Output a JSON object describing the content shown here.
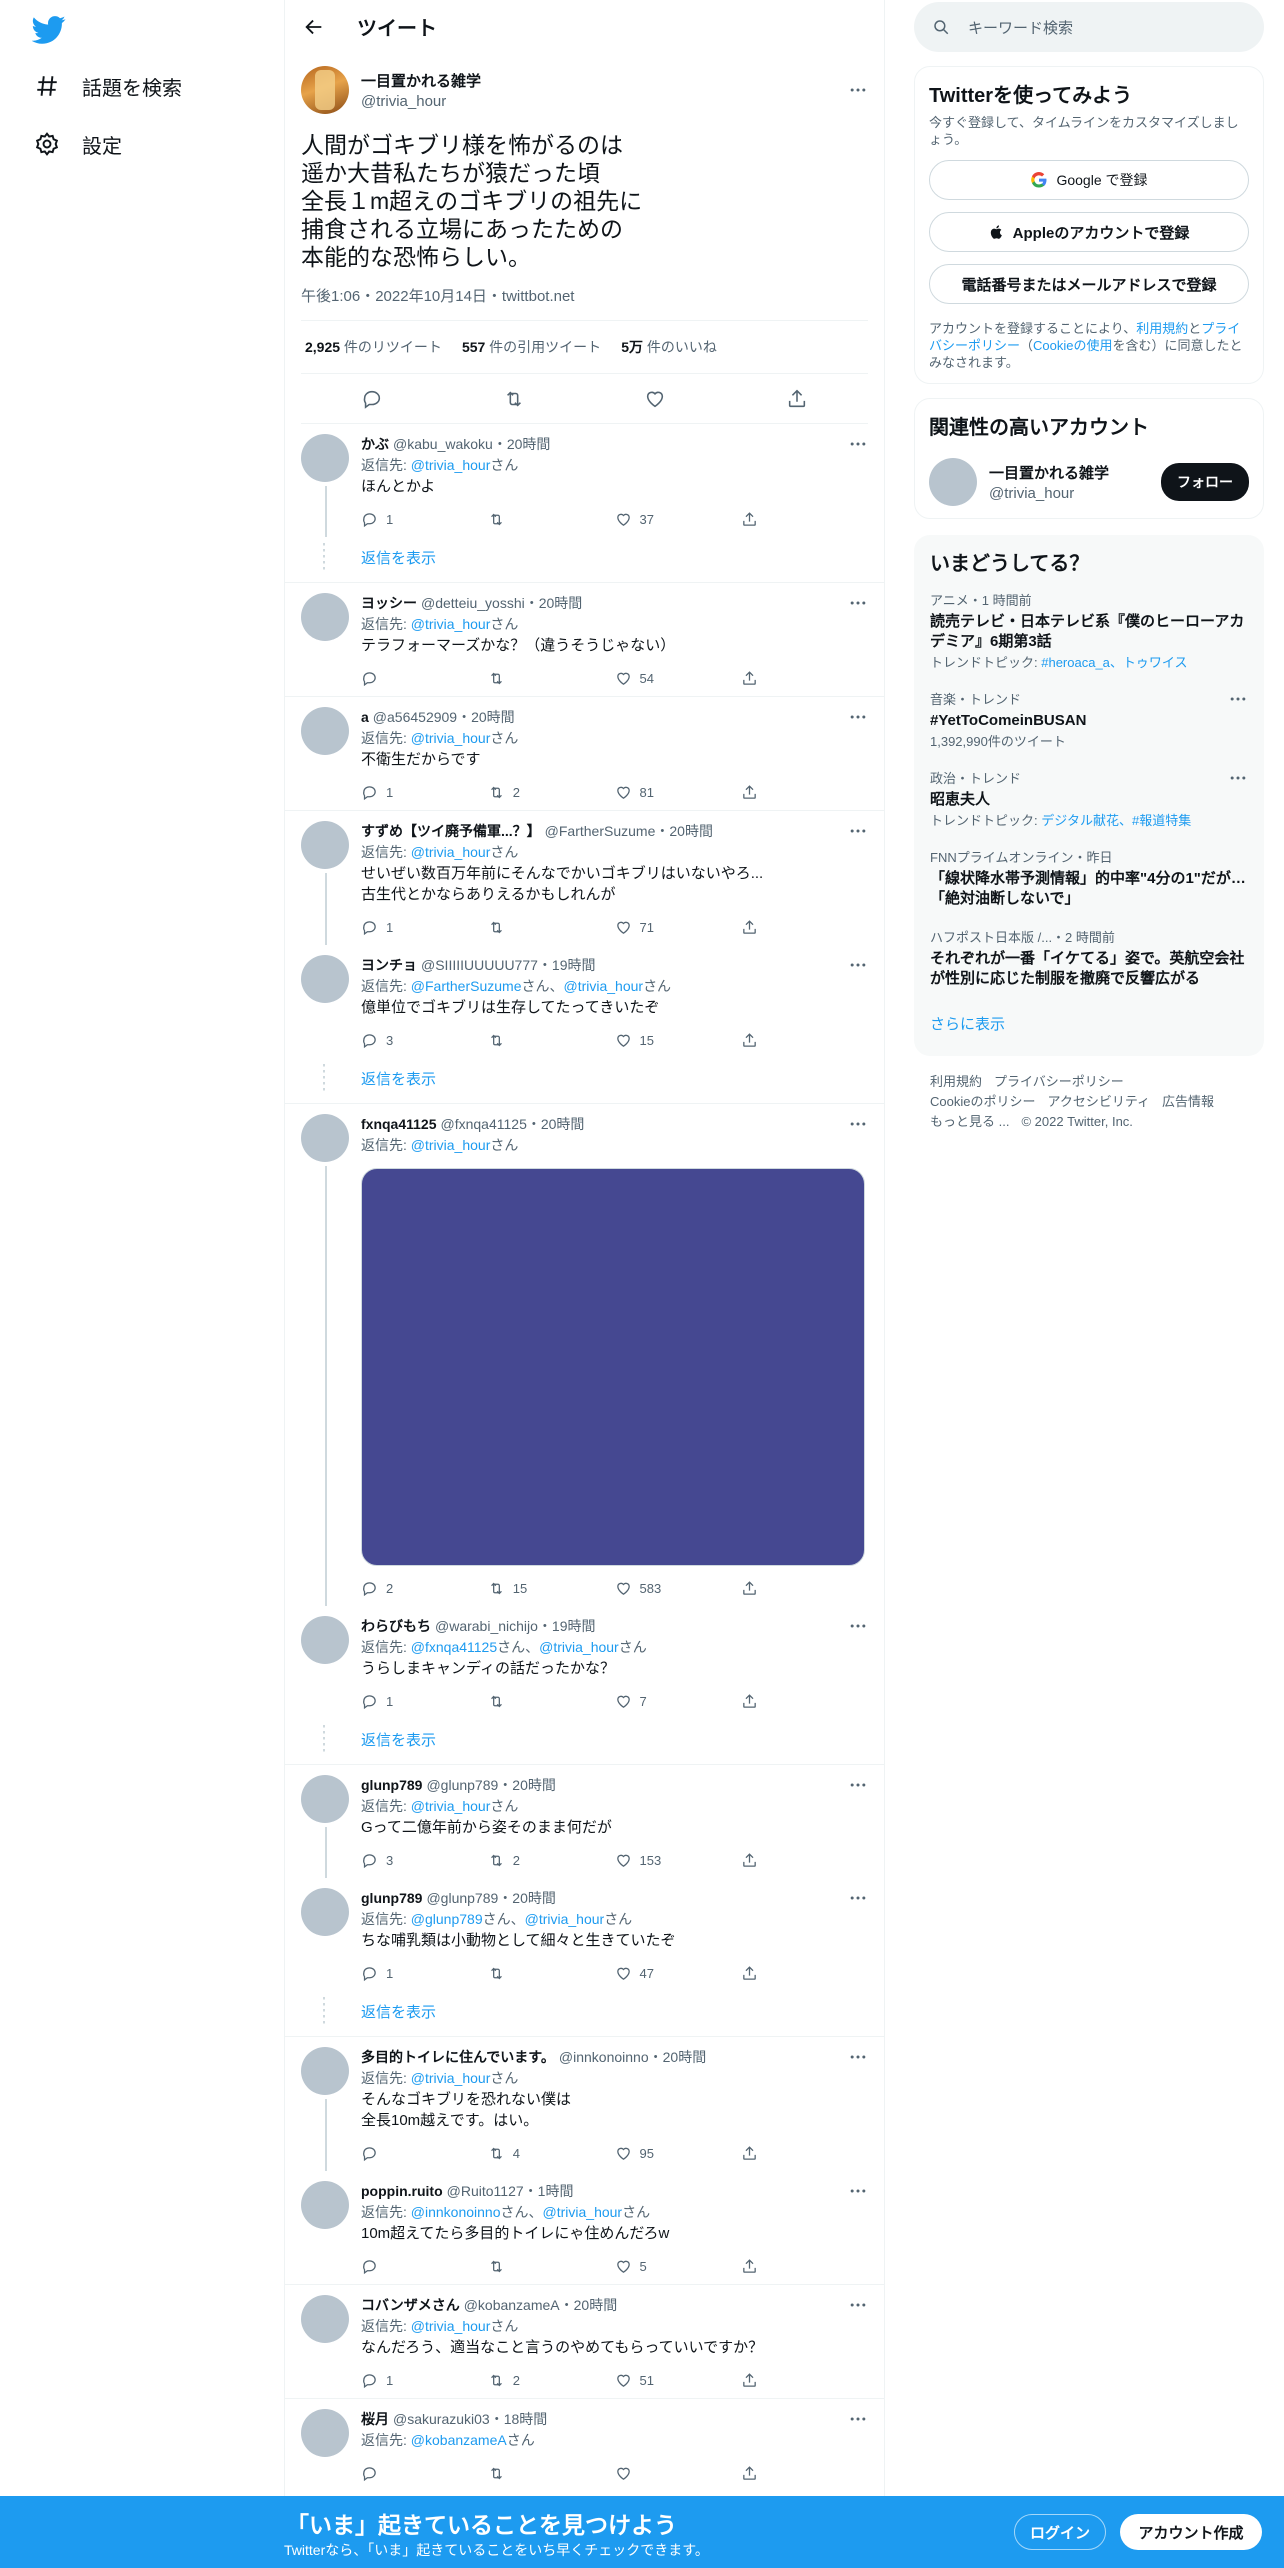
{
  "nav": {
    "explore": "話題を検索",
    "settings": "設定"
  },
  "header": {
    "title": "ツイート"
  },
  "main_tweet": {
    "name": "一目置かれる雑学",
    "handle": "@trivia_hour",
    "text": "人間がゴキブリ様を怖がるのは\n遥か大昔私たちが猿だった頃\n全長１m超えのゴキブリの祖先に\n捕食される立場にあったための\n本能的な恐怖らしい。",
    "meta": "午後1:06・2022年10月14日・twittbot.net",
    "retweets_count": "2,925",
    "retweets_label": " 件のリツイート",
    "quotes_count": "557",
    "quotes_label": " 件の引用ツイート",
    "likes_count": "5万",
    "likes_label": " 件のいいね"
  },
  "labels": {
    "reply_to": "返信先: ",
    "san": "さん",
    "comma": "、",
    "show_replies": "返信を表示"
  },
  "replies": [
    {
      "name": "かぶ",
      "handle": "@kabu_wakoku・20時間",
      "to": [
        "@trivia_hour"
      ],
      "text": "ほんとかよ",
      "reply": "1",
      "rt": "",
      "like": "37"
    },
    {
      "name": "ヨッシー",
      "handle": "@detteiu_yosshi・20時間",
      "to": [
        "@trivia_hour"
      ],
      "text": "テラフォーマーズかな？（違うそうじゃない）",
      "reply": "",
      "rt": "",
      "like": "54"
    },
    {
      "name": "a",
      "handle": "@a56452909・20時間",
      "to": [
        "@trivia_hour"
      ],
      "text": "不衛生だからです",
      "reply": "1",
      "rt": "2",
      "like": "81"
    },
    {
      "name": "すずめ【ツイ廃予備軍...？】",
      "handle": "@FartherSuzume・20時間",
      "to": [
        "@trivia_hour"
      ],
      "text": "せいぜい数百万年前にそんなでかいゴキブリはいないやろ...\n古生代とかならありえるかもしれんが",
      "reply": "1",
      "rt": "",
      "like": "71"
    },
    {
      "name": "ヨンチョ",
      "handle": "@SIIIIIUUUUU777・19時間",
      "to": [
        "@FartherSuzume",
        "@trivia_hour"
      ],
      "text": "億単位でゴキブリは生存してたってきいたぞ",
      "reply": "3",
      "rt": "",
      "like": "15"
    },
    {
      "name": "fxnqa41125",
      "handle": "@fxnqa41125・20時間",
      "to": [
        "@trivia_hour"
      ],
      "text": "",
      "reply": "2",
      "rt": "15",
      "like": "583"
    },
    {
      "name": "わらびもち",
      "handle": "@warabi_nichijo・19時間",
      "to": [
        "@fxnqa41125",
        "@trivia_hour"
      ],
      "text": "うらしまキャンディの話だったかな？",
      "reply": "1",
      "rt": "",
      "like": "7"
    },
    {
      "name": "glunp789",
      "handle": "@glunp789・20時間",
      "to": [
        "@trivia_hour"
      ],
      "text": "Gって二億年前から姿そのまま何だが",
      "reply": "3",
      "rt": "2",
      "like": "153"
    },
    {
      "name": "glunp789",
      "handle": "@glunp789・20時間",
      "to": [
        "@glunp789",
        "@trivia_hour"
      ],
      "text": "ちな哺乳類は小動物として細々と生きていたぞ",
      "reply": "1",
      "rt": "",
      "like": "47"
    },
    {
      "name": "多目的トイレに住んでいます。",
      "handle": "@innkonoinno・20時間",
      "to": [
        "@trivia_hour"
      ],
      "text": "そんなゴキブリを恐れない僕は\n全長10m越えです。はい。",
      "reply": "",
      "rt": "4",
      "like": "95"
    },
    {
      "name": "poppin.ruito",
      "handle": "@Ruito1127・1時間",
      "to": [
        "@innkonoinno",
        "@trivia_hour"
      ],
      "text": "10m超えてたら多目的トイレにゃ住めんだろw",
      "reply": "",
      "rt": "",
      "like": "5"
    },
    {
      "name": "コバンザメさん",
      "handle": "@kobanzameA・20時間",
      "to": [
        "@trivia_hour"
      ],
      "text": "なんだろう、適当なこと言うのやめてもらっていいですか？",
      "reply": "1",
      "rt": "2",
      "like": "51"
    },
    {
      "name": "桜月",
      "handle": "@sakurazuki03・18時間",
      "to": [
        "@kobanzameA"
      ],
      "text": "",
      "reply": "",
      "rt": "",
      "like": ""
    }
  ],
  "right": {
    "search_placeholder": "キーワード検索",
    "signup_title": "Twitterを使ってみよう",
    "signup_sub": "今すぐ登録して、タイムラインをカスタマイズしましょう。",
    "google_btn": "Google で登録",
    "apple_btn": "Appleのアカウントで登録",
    "phone_btn": "電話番号またはメールアドレスで登録",
    "legal_1": "アカウントを登録することにより、",
    "legal_link1": "利用規約",
    "legal_2": "と",
    "legal_link2": "プライバシーポリシー",
    "legal_3": "（",
    "legal_link3": "Cookieの使用",
    "legal_4": "を含む）に同意したとみなされます。",
    "related_title": "関連性の高いアカウント",
    "related_name": "一目置かれる雑学",
    "related_handle": "@trivia_hour",
    "follow": "フォロー",
    "trends_title": "いまどうしてる？",
    "trends": [
      {
        "ctx": "アニメ・1 時間前",
        "title": "読売テレビ・日本テレビ系『僕のヒーローアカデミア』6期第3話",
        "topic_label": "トレンドトピック: ",
        "topic": "#heroaca_a、トゥワイス"
      },
      {
        "ctx": "音楽・トレンド",
        "title": "#YetToComeinBUSAN",
        "topic_label": "",
        "topic": "1,392,990件のツイート"
      },
      {
        "ctx": "政治・トレンド",
        "title": "昭恵夫人",
        "topic_label": "トレンドトピック: ",
        "topic": "デジタル献花、#報道特集"
      },
      {
        "ctx": "FNNプライムオンライン・昨日",
        "title": "「線状降水帯予測情報」的中率\"4分の1\"だが…「絶対油断しないで」",
        "topic_label": "",
        "topic": ""
      },
      {
        "ctx": "ハフポスト日本版 /...・2 時間前",
        "title": "それぞれが一番「イケてる」姿で。英航空会社が性別に応じた制服を撤廃で反響広がる",
        "topic_label": "",
        "topic": ""
      }
    ],
    "show_more": "さらに表示",
    "footer": [
      "利用規約",
      "プライバシーポリシー",
      "Cookieのポリシー",
      "アクセシビリティ",
      "広告情報",
      "もっと見る ...",
      "© 2022 Twitter, Inc."
    ]
  },
  "banner": {
    "headline": "「いま」起きていることを見つけよう",
    "sub": "Twitterなら、「いま」起きていることをいち早くチェックできます。",
    "login": "ログイン",
    "signup": "アカウント作成"
  },
  "colors": {
    "accent": "#1d9bf0",
    "media": "#454891"
  }
}
